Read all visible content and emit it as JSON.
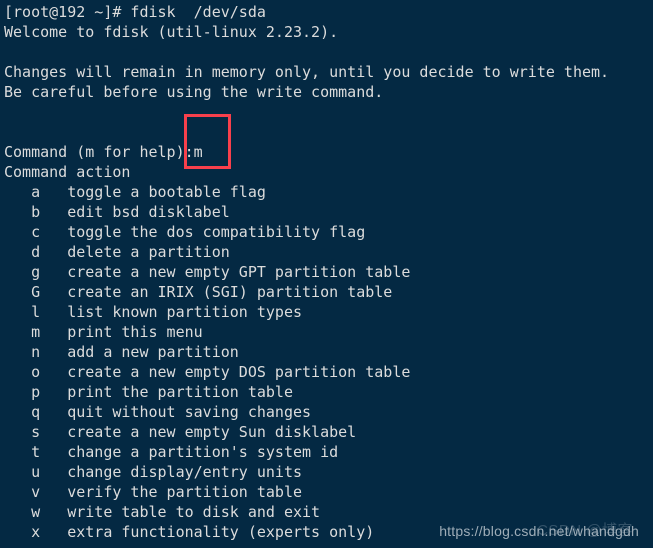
{
  "terminal": {
    "background_color": "#042943",
    "text_color": "#dcdcdc",
    "prompt_line": "[root@192 ~]# fdisk  /dev/sda",
    "welcome_line": "Welcome to fdisk (util-linux 2.23.2).",
    "notice_line_1": "Changes will remain in memory only, until you decide to write them.",
    "notice_line_2": "Be careful before using the write command.",
    "command_prompt_line": "Command (m for help):",
    "typed_command": "m",
    "command_action_header": "Command action",
    "menu": [
      {
        "key": "a",
        "description": "toggle a bootable flag"
      },
      {
        "key": "b",
        "description": "edit bsd disklabel"
      },
      {
        "key": "c",
        "description": "toggle the dos compatibility flag"
      },
      {
        "key": "d",
        "description": "delete a partition"
      },
      {
        "key": "g",
        "description": "create a new empty GPT partition table"
      },
      {
        "key": "G",
        "description": "create an IRIX (SGI) partition table"
      },
      {
        "key": "l",
        "description": "list known partition types"
      },
      {
        "key": "m",
        "description": "print this menu"
      },
      {
        "key": "n",
        "description": "add a new partition"
      },
      {
        "key": "o",
        "description": "create a new empty DOS partition table"
      },
      {
        "key": "p",
        "description": "print the partition table"
      },
      {
        "key": "q",
        "description": "quit without saving changes"
      },
      {
        "key": "s",
        "description": "create a new empty Sun disklabel"
      },
      {
        "key": "t",
        "description": "change a partition's system id"
      },
      {
        "key": "u",
        "description": "change display/entry units"
      },
      {
        "key": "v",
        "description": "verify the partition table"
      },
      {
        "key": "w",
        "description": "write table to disk and exit"
      },
      {
        "key": "x",
        "description": "extra functionality (experts only)"
      }
    ]
  },
  "annotation": {
    "highlight_color": "#f8404c"
  },
  "watermark": {
    "url": "https://blog.csdn.net/whandgdh",
    "logo_text": "CSDN @博客"
  }
}
